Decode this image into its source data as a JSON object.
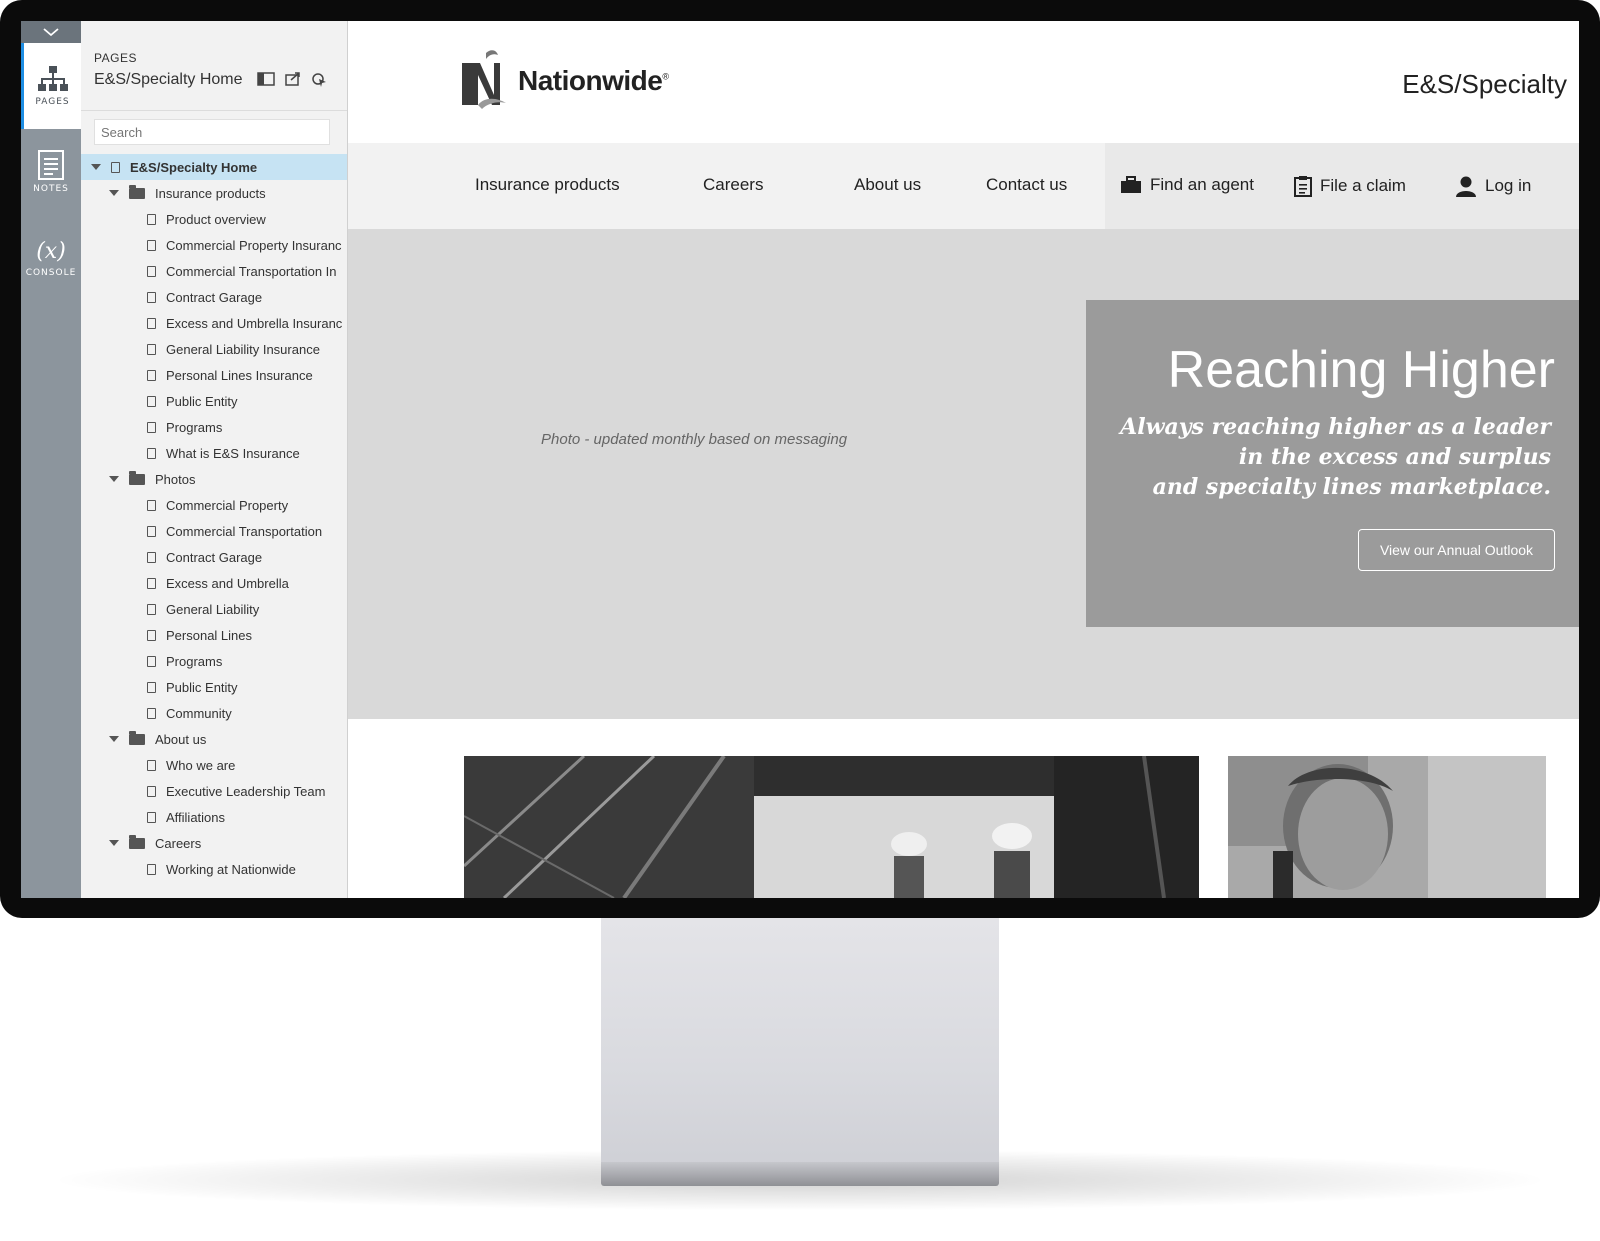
{
  "rail": {
    "items": [
      {
        "label": "PAGES"
      },
      {
        "label": "NOTES"
      },
      {
        "label": "CONSOLE",
        "glyph": "(x)"
      }
    ]
  },
  "panel": {
    "caption": "PAGES",
    "title": "E&S/Specialty Home",
    "search_placeholder": "Search",
    "tree": [
      {
        "label": "E&S/Specialty Home",
        "type": "page",
        "level": 0,
        "expandable": true,
        "selected": true
      },
      {
        "label": "Insurance products",
        "type": "folder",
        "level": 1
      },
      {
        "label": "Product overview",
        "type": "page",
        "level": 2
      },
      {
        "label": "Commercial Property Insuranc",
        "type": "page",
        "level": 2
      },
      {
        "label": "Commercial Transportation In",
        "type": "page",
        "level": 2
      },
      {
        "label": "Contract Garage",
        "type": "page",
        "level": 2
      },
      {
        "label": "Excess and Umbrella Insuranc",
        "type": "page",
        "level": 2
      },
      {
        "label": "General Liability Insurance",
        "type": "page",
        "level": 2
      },
      {
        "label": "Personal Lines Insurance",
        "type": "page",
        "level": 2
      },
      {
        "label": "Public Entity",
        "type": "page",
        "level": 2
      },
      {
        "label": "Programs",
        "type": "page",
        "level": 2
      },
      {
        "label": "What is E&S Insurance",
        "type": "page",
        "level": 2
      },
      {
        "label": "Photos",
        "type": "folder",
        "level": 1
      },
      {
        "label": "Commercial Property",
        "type": "page",
        "level": 2
      },
      {
        "label": "Commercial Transportation",
        "type": "page",
        "level": 2
      },
      {
        "label": "Contract Garage",
        "type": "page",
        "level": 2
      },
      {
        "label": "Excess and Umbrella",
        "type": "page",
        "level": 2
      },
      {
        "label": "General Liability",
        "type": "page",
        "level": 2
      },
      {
        "label": "Personal Lines",
        "type": "page",
        "level": 2
      },
      {
        "label": "Programs",
        "type": "page",
        "level": 2
      },
      {
        "label": "Public Entity",
        "type": "page",
        "level": 2
      },
      {
        "label": "Community",
        "type": "page",
        "level": 2
      },
      {
        "label": "About us",
        "type": "folder",
        "level": 1
      },
      {
        "label": "Who we are",
        "type": "page",
        "level": 2
      },
      {
        "label": "Executive Leadership Team",
        "type": "page",
        "level": 2
      },
      {
        "label": "Affiliations",
        "type": "page",
        "level": 2
      },
      {
        "label": "Careers",
        "type": "folder",
        "level": 1
      },
      {
        "label": "Working at Nationwide",
        "type": "page",
        "level": 2
      }
    ]
  },
  "site": {
    "brand": "Nationwide",
    "brand_mark": "®",
    "title": "E&S/Specialty",
    "nav": [
      "Insurance products",
      "Careers",
      "About us",
      "Contact us"
    ],
    "utility": [
      {
        "label": "Find an agent",
        "icon": "briefcase-icon"
      },
      {
        "label": "File a claim",
        "icon": "clipboard-icon"
      },
      {
        "label": "Log in",
        "icon": "user-icon"
      }
    ],
    "hero": {
      "caption": "Photo - updated monthly based on messaging",
      "heading": "Reaching Higher",
      "subline1": "Always reaching higher as a leader",
      "subline2": "in the excess and surplus",
      "subline3": "and specialty lines marketplace.",
      "cta": "View our Annual Outlook"
    }
  }
}
